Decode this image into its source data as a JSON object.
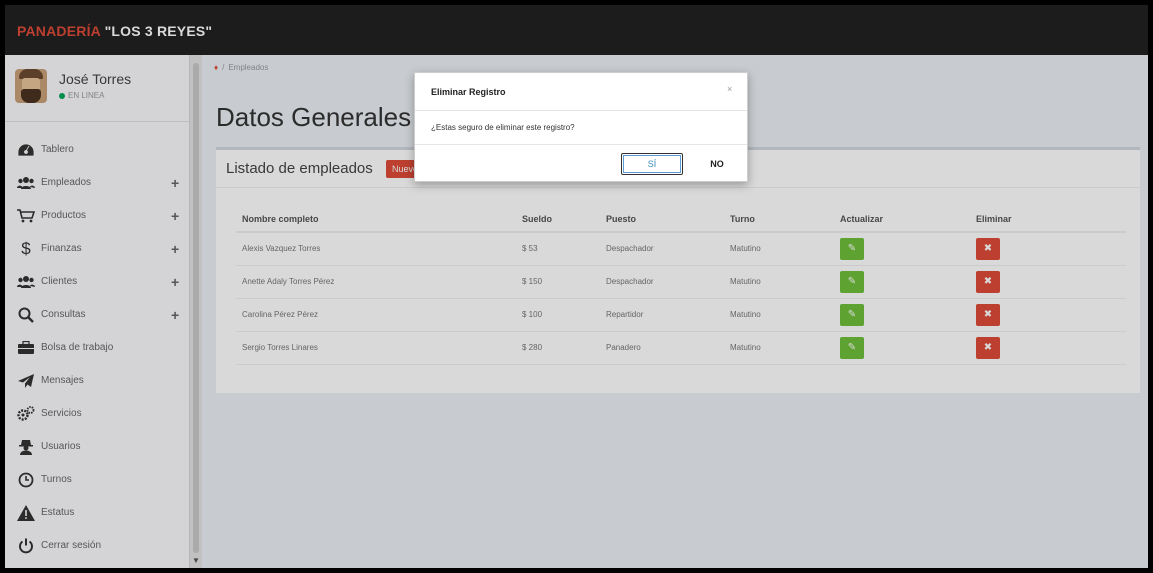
{
  "brand": {
    "part1": "PANADERÍA",
    "part2": " \"LOS 3 REYES\""
  },
  "user": {
    "name": "José Torres",
    "status": "EN LINEA"
  },
  "menu": [
    {
      "label": "Tablero",
      "icon": "dashboard-icon",
      "expand": ""
    },
    {
      "label": "Empleados",
      "icon": "users-icon",
      "expand": "+"
    },
    {
      "label": "Productos",
      "icon": "cart-icon",
      "expand": "+"
    },
    {
      "label": "Finanzas",
      "icon": "dollar-icon",
      "expand": "+"
    },
    {
      "label": "Clientes",
      "icon": "users-icon",
      "expand": "+"
    },
    {
      "label": "Consultas",
      "icon": "search-icon",
      "expand": "+"
    },
    {
      "label": "Bolsa de trabajo",
      "icon": "briefcase-icon",
      "expand": ""
    },
    {
      "label": "Mensajes",
      "icon": "paper-plane-icon",
      "expand": ""
    },
    {
      "label": "Servicios",
      "icon": "gears-icon",
      "expand": ""
    },
    {
      "label": "Usuarios",
      "icon": "user-secret-icon",
      "expand": ""
    },
    {
      "label": "Turnos",
      "icon": "clock-icon",
      "expand": ""
    },
    {
      "label": "Estatus",
      "icon": "warning-icon",
      "expand": ""
    },
    {
      "label": "Cerrar sesión",
      "icon": "power-icon",
      "expand": ""
    }
  ],
  "breadcrumb": {
    "current": "Empleados"
  },
  "page_title": "Datos Generales",
  "card": {
    "title": "Listado de empleados",
    "new_button": "Nuevo"
  },
  "table": {
    "headers": [
      "Nombre completo",
      "Sueldo",
      "Puesto",
      "Turno",
      "Actualizar",
      "Eliminar"
    ],
    "rows": [
      [
        "Alexis Vazquez Torres",
        "$ 53",
        "Despachador",
        "Matutino"
      ],
      [
        "Anette Adaly Torres Pérez",
        "$ 150",
        "Despachador",
        "Matutino"
      ],
      [
        "Carolina Pérez Pérez",
        "$ 100",
        "Repartidor",
        "Matutino"
      ],
      [
        "Sergio Torres Linares",
        "$ 280",
        "Panadero",
        "Matutino"
      ]
    ]
  },
  "modal": {
    "title": "Eliminar Registro",
    "close": "×",
    "message": "¿Estas seguro de eliminar este registro?",
    "yes_label": "SÍ",
    "no_label": "NO"
  },
  "colors": {
    "brand_red": "#dd4b39",
    "update_green": "#6fbf3a",
    "delete_red": "#dd4b39"
  }
}
